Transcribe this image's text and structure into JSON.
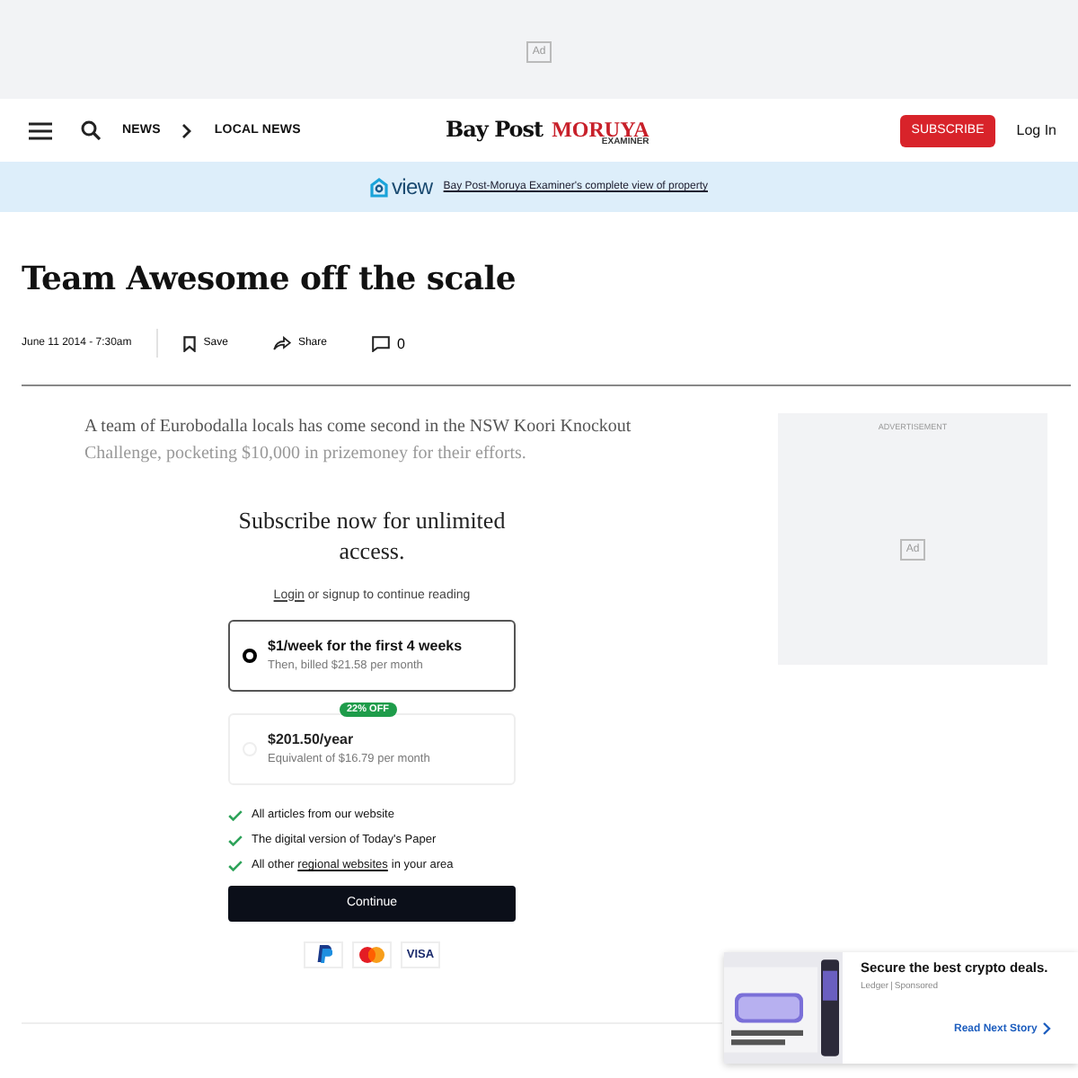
{
  "top_ad": {
    "label": "Ad"
  },
  "header": {
    "breadcrumbs": [
      "NEWS",
      "LOCAL NEWS"
    ],
    "logo": {
      "main": "Bay Post",
      "second": "MORUYA",
      "sub": "EXAMINER"
    },
    "subscribe": "SUBSCRIBE",
    "login": "Log In"
  },
  "banner": {
    "brand": "view",
    "link": "Bay Post-Moruya Examiner's complete view of property"
  },
  "article": {
    "title": "Team Awesome off the scale",
    "date": "June 11 2014 - 7:30am",
    "save": "Save",
    "share": "Share",
    "comments": "0",
    "lead": [
      "A team of Eurobodalla locals has come second in the NSW Koori Knockout",
      "Challenge, pocketing $10,000 in prizemoney for their efforts."
    ]
  },
  "side_ad": {
    "label": "ADVERTISEMENT",
    "mark": "Ad"
  },
  "paywall": {
    "heading": "Subscribe now for unlimited access.",
    "login": "Login",
    "login_rest": "or signup to continue reading",
    "plans": [
      {
        "price": "$1/week for the first 4 weeks",
        "note": "Then, billed $21.58 per month",
        "selected": true
      },
      {
        "badge": "22% OFF",
        "price": "$201.50/year",
        "note": "Equivalent of $16.79 per month",
        "selected": false
      }
    ],
    "benefits": [
      {
        "before": "All articles from our website"
      },
      {
        "before": "The digital version of Today's Paper"
      },
      {
        "before": "All other",
        "link": "regional websites",
        "after": "in your area"
      }
    ],
    "continue": "Continue",
    "payments": [
      {
        "kind": "paypal"
      },
      {
        "kind": "mastercard"
      },
      {
        "kind": "visa",
        "label": "VISA"
      }
    ]
  },
  "promo": {
    "kind": "picture",
    "title": "Secure the best crypto deals.",
    "source": "Ledger",
    "sep": "|",
    "tag": "Sponsored",
    "next": "Read Next Story"
  }
}
